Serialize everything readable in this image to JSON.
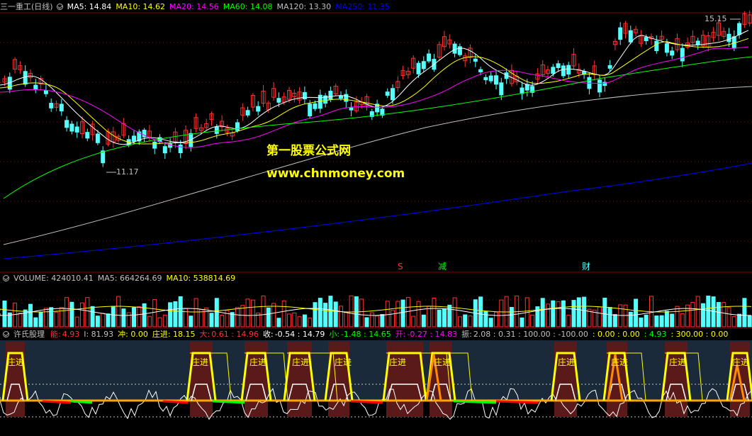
{
  "main_header": {
    "title": "三一重工(日线)",
    "ma5": "MA5: 14.84",
    "ma10": "MA10: 14.62",
    "ma20": "MA20: 14.56",
    "ma60": "MA60: 14.08",
    "ma120": "MA120: 13.30",
    "ma250": "MA250: 11.35"
  },
  "price_labels": {
    "high": "15.15",
    "low": "11.17"
  },
  "watermark": {
    "line1": "第一股票公式网",
    "line2": "www.chnmoney.com"
  },
  "event_markers": {
    "s": "S",
    "jian": "减",
    "cai": "财"
  },
  "volume_header": {
    "volume": "VOLUME: 424010.41",
    "ma5": "MA5: 664264.69",
    "ma10": "MA10: 538814.69"
  },
  "indicator_header": {
    "name": "许氏股理",
    "neng_label": "能:",
    "neng_val": "4.93",
    "i": "I: 81.93",
    "chong": "冲: 0.00",
    "zhuangjin": "庄进: 18.15",
    "da_label": "大:",
    "da_val": "0.61 : 14.96",
    "shou_label": "收:",
    "shou_val": "-0.54 : 14.79",
    "xiao_label": "小:",
    "xiao_val": "-1.48 : 14.65",
    "kai_label": "开:",
    "kai_val": "-0.27 : 14.83",
    "zhen_label": "振:",
    "zhen_val": "2.08 : 0.31 : 100.00 : -100.00",
    "extra1": ": 0.00 : 0.00",
    "extra2": ": 4.93",
    "extra3": ": 300.00 : 0.00"
  },
  "zhuangjin_label": "庄进",
  "colors": {
    "up": "#ff3232",
    "down": "#54ffff",
    "ma5": "#ffffff",
    "ma10": "#ffff00",
    "ma20": "#ff00ff",
    "ma60": "#00ff00",
    "ma120": "#c0c0c0",
    "ma250": "#0000ff",
    "grid": "#8b0000"
  }
}
